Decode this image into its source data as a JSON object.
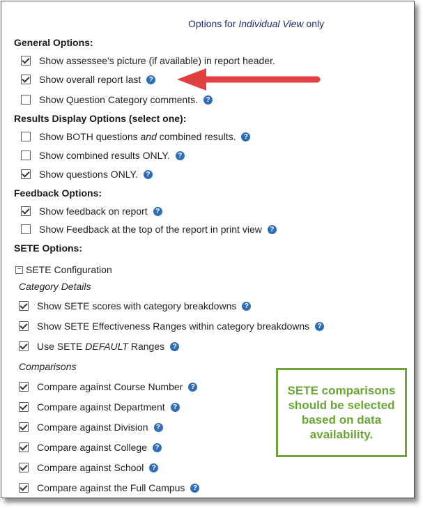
{
  "header": {
    "prefix": "Options for ",
    "view": "Individual View",
    "suffix": " only"
  },
  "sections": {
    "general": "General Options:",
    "results": "Results Display Options (select one):",
    "feedback": "Feedback Options:",
    "sete": "SETE Options:"
  },
  "general": [
    {
      "label": "Show assessee's picture (if available) in report header.",
      "checked": true,
      "help": false
    },
    {
      "label": "Show overall report last",
      "checked": true,
      "help": true
    },
    {
      "label": "Show Question Category comments.",
      "checked": false,
      "help": true
    }
  ],
  "results": [
    {
      "pre": "Show BOTH questions ",
      "em": "and",
      "post": " combined results.",
      "checked": false
    },
    {
      "label": "Show combined results ONLY.",
      "checked": false
    },
    {
      "label": "Show questions ONLY.",
      "checked": true
    }
  ],
  "feedback": [
    {
      "label": "Show feedback on report",
      "checked": true
    },
    {
      "label": "Show Feedback at the top of the report in print view",
      "checked": false
    }
  ],
  "sete_config": {
    "toggle": "−",
    "label": "SETE Configuration"
  },
  "category_details": {
    "title": "Category Details",
    "items": [
      {
        "label": "Show SETE scores with category breakdowns",
        "checked": true
      },
      {
        "label": "Show SETE Effectiveness Ranges within category breakdowns",
        "checked": true
      },
      {
        "pre": "Use SETE ",
        "em": "DEFAULT",
        "post": " Ranges",
        "checked": true
      }
    ]
  },
  "comparisons": {
    "title": "Comparisons",
    "items": [
      {
        "label": "Compare against Course Number",
        "checked": true
      },
      {
        "label": "Compare against Department",
        "checked": true
      },
      {
        "label": "Compare against Division",
        "checked": true
      },
      {
        "label": "Compare against College",
        "checked": true
      },
      {
        "label": "Compare against School",
        "checked": true
      },
      {
        "label": "Compare against the Full Campus",
        "checked": true
      }
    ]
  },
  "callout": "SETE comparisons should be selected based on data availability.",
  "help_glyph": "?",
  "colors": {
    "help": "#2f6eb5",
    "callout": "#6aa536",
    "arrow": "#e04040",
    "header": "#1f2d6b"
  }
}
